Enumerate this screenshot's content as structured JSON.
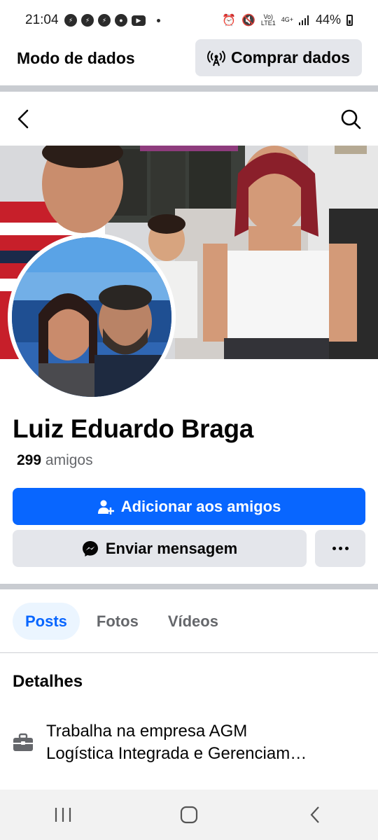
{
  "status_bar": {
    "time": "21:04",
    "net_top": "Vo)",
    "net_bottom": "LTE1",
    "net4g": "4G+",
    "battery": "44%"
  },
  "data_mode": {
    "title": "Modo de dados",
    "buy_label": "Comprar dados"
  },
  "profile": {
    "name": "Luiz Eduardo Braga",
    "friends_count": "299",
    "friends_label": "amigos"
  },
  "actions": {
    "add_friend": "Adicionar aos amigos",
    "send_message": "Enviar mensagem"
  },
  "tabs": [
    {
      "label": "Posts",
      "active": true
    },
    {
      "label": "Fotos",
      "active": false
    },
    {
      "label": "Vídeos",
      "active": false
    }
  ],
  "details": {
    "title": "Detalhes",
    "work": "Trabalha na empresa AGM Logística Integrada e Gerenciam…",
    "work_line1": "Trabalha na empresa AGM",
    "work_line2": "Logística Integrada e Gerenciam…"
  },
  "colors": {
    "accent": "#0866ff",
    "button_gray": "#e4e6eb",
    "tab_active_bg": "#ebf5ff"
  },
  "icons": [
    "back-arrow-icon",
    "search-icon",
    "antenna-icon",
    "add-friend-icon",
    "messenger-icon",
    "more-icon",
    "briefcase-icon",
    "recents-icon",
    "home-icon",
    "nav-back-icon"
  ]
}
